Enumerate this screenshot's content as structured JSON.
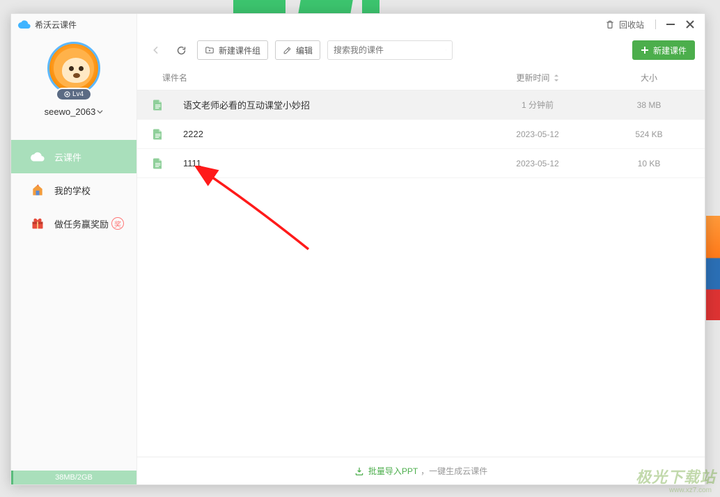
{
  "window": {
    "title": "希沃云课件"
  },
  "titlebar": {
    "recycle_label": "回收站"
  },
  "user": {
    "name": "seewo_2063",
    "level": "Lv4"
  },
  "sidebar": {
    "items": [
      {
        "label": "云课件"
      },
      {
        "label": "我的学校"
      },
      {
        "label": "做任务赢奖励",
        "badge": "奖"
      }
    ],
    "storage": {
      "text": "38MB/2GB",
      "percent": 1.86
    }
  },
  "toolbar": {
    "new_group": "新建课件组",
    "edit": "编辑",
    "search_placeholder": "搜索我的课件",
    "new_courseware": "新建课件"
  },
  "table": {
    "headers": {
      "name": "课件名",
      "time": "更新时间",
      "size": "大小"
    },
    "rows": [
      {
        "name": "语文老师必看的互动课堂小妙招",
        "time": "1 分钟前",
        "size": "38 MB",
        "selected": true
      },
      {
        "name": "2222",
        "time": "2023-05-12",
        "size": "524 KB"
      },
      {
        "name": "1111",
        "time": "2023-05-12",
        "size": "10 KB"
      }
    ]
  },
  "footer": {
    "import": "批量导入PPT",
    "rest": "，一键生成云课件"
  },
  "watermark": {
    "main": "极光下载站",
    "sub": "www.xz7.com"
  }
}
